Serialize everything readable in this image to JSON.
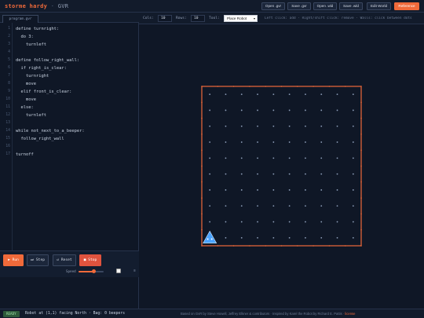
{
  "app": {
    "name": "storme hardy",
    "separator": "·",
    "subtitle": "GVR"
  },
  "toolbar": {
    "buttons": [
      {
        "label": "Open .gvr"
      },
      {
        "label": "Save .gvr"
      },
      {
        "label": "Open .wld"
      },
      {
        "label": "Save .wld"
      },
      {
        "label": "Edit World"
      },
      {
        "label": "Reference"
      }
    ]
  },
  "editor": {
    "tab_label": "program.gvr",
    "lines": [
      "define turnright:",
      "  do 3:",
      "    turnleft",
      "",
      "define follow_right_wall:",
      "  if right_is_clear:",
      "    turnright",
      "    move",
      "  elif front_is_clear:",
      "    move",
      "  else:",
      "    turnleft",
      "",
      "while not_next_to_a_beeper:",
      "  follow_right_wall",
      "",
      "turnoff"
    ]
  },
  "controls": {
    "run_label": "Run",
    "step_label": "Step",
    "reset_label": "Reset",
    "stop_label": "Stop",
    "speed_label": "Speed",
    "speed_value": 0.6,
    "trace_label": "≡"
  },
  "settings": {
    "cols_label": "Cols:",
    "cols_value": "10",
    "rows_label": "Rows:",
    "rows_value": "10",
    "tool_label": "Tool:",
    "tool_value": "Place Robot",
    "hint": "Left click: add · Right/shift click: remove · Walls: click between dots"
  },
  "world": {
    "cols": 10,
    "rows": 10,
    "robot_street": 1,
    "robot_avenue": 1,
    "robot_direction": "North",
    "colors": {
      "wall": "#f06a3a",
      "dot": "#8fa0bb",
      "robot": "#4aa3ff"
    }
  },
  "status": {
    "badge": "READY",
    "text": "Robot at (1,1) facing North · Bag: 0 beepers",
    "credits": "Based on GvR by Steve Howell, Jeffrey Elkner & contributors · Inspired by Karel the Robot by Richard E. Pattis ·",
    "credits_link": "license"
  }
}
